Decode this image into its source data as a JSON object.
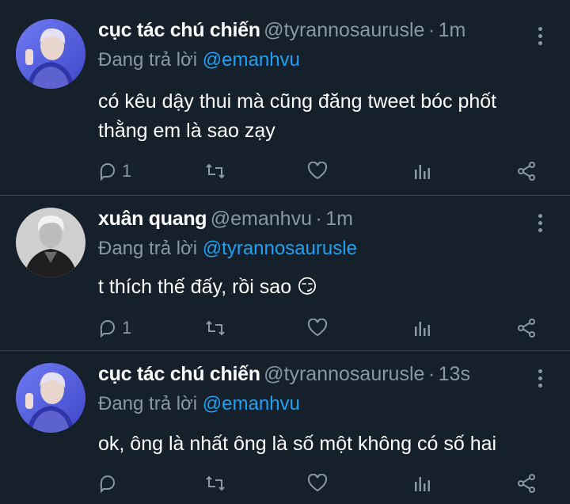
{
  "colors": {
    "background": "#15202b",
    "muted": "#8899a6",
    "accent": "#1da1f2",
    "divider": "#38444d"
  },
  "reply_prefix": "Đang trả lời",
  "tweets": [
    {
      "name": "cục tác chú chiến",
      "handle": "@tyrannosaurusle",
      "dot": "·",
      "time": "1m",
      "reply_to": "@emanhvu",
      "text_lines": [
        "có kêu dậy thui mà cũng đăng tweet bóc phốt",
        "thằng em là sao zạy"
      ],
      "reply_count": "1",
      "avatar": "avatar-blue-person"
    },
    {
      "name": "xuân quang",
      "handle": "@emanhvu",
      "dot": "·",
      "time": "1m",
      "reply_to": "@tyrannosaurusle",
      "text_lines": [
        "t thích thế đấy, rồi sao 😏"
      ],
      "reply_count": "1",
      "avatar": "avatar-grayscale-person"
    },
    {
      "name": "cục tác chú chiến",
      "handle": "@tyrannosaurusle",
      "dot": "·",
      "time": "13s",
      "reply_to": "@emanhvu",
      "text_lines": [
        "ok, ông là nhất ông là số một không có số hai"
      ],
      "reply_count": "",
      "avatar": "avatar-blue-person"
    }
  ]
}
